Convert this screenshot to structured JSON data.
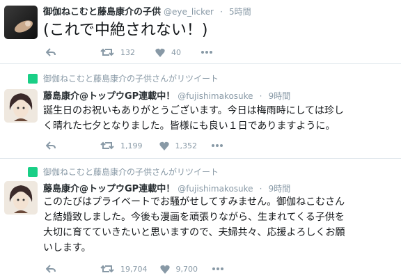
{
  "tweets": [
    {
      "name": "御伽ねこむと藤島康介の子供",
      "handle": "@eye_licker",
      "time": "5時間",
      "text": "(これで中絶されない！)",
      "retweets": "132",
      "likes": "40"
    },
    {
      "retweeted_by": "御伽ねこむと藤島康介の子供さんがリツイート",
      "name": "藤島康介@トップウGP連載中！",
      "handle": "@fujishimakosuke",
      "time": "9時間",
      "text_lines": [
        "誕生日のお祝いもありがとうございます。今日は梅雨時にしては珍し",
        "く晴れた七夕となりました。皆様にも良い１日でありますように。"
      ],
      "retweets": "1,199",
      "likes": "1,352"
    },
    {
      "retweeted_by": "御伽ねこむと藤島康介の子供さんがリツイート",
      "name": "藤島康介@トップウGP連載中！",
      "handle": "@fujishimakosuke",
      "time": "9時間",
      "text_lines": [
        "このたびはプライベートでお騒がせしてすみません。御伽ねこむさん",
        "と結婚致しました。今後も漫画を頑張りながら、生まれてくる子供を",
        "大切に育てていきたいと思いますので、夫婦共々、応援よろしくお願",
        "いします。"
      ],
      "retweets": "19,704",
      "likes": "9,700"
    }
  ],
  "time_sep": "·",
  "colors": {
    "muted": "#8899a6",
    "retweet_badge": "#19cf86"
  }
}
